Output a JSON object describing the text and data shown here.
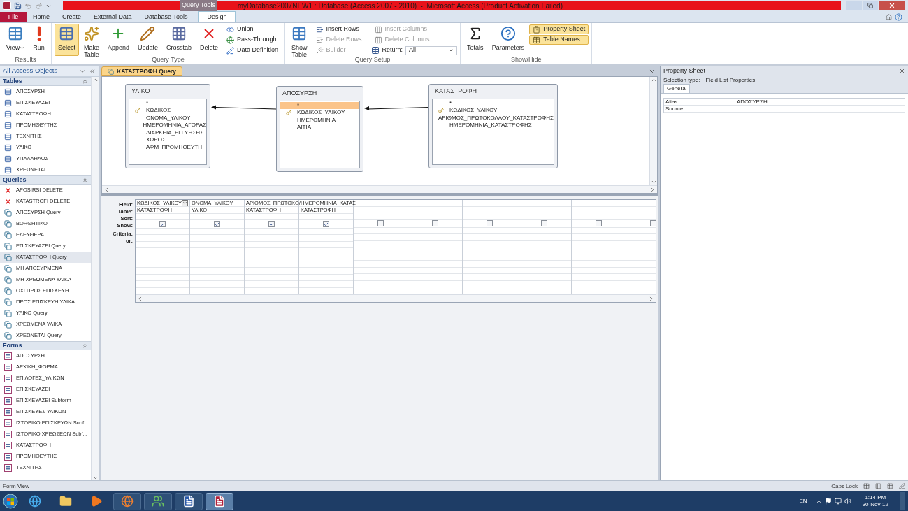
{
  "window": {
    "title": "myDatabase2007NEW1 : Database (Access 2007 - 2010)  -  Microsoft Access (Product Activation Failed)",
    "context_tab": "Query Tools"
  },
  "ribbon_tabs": [
    {
      "label": "File",
      "kind": "file",
      "selected": false
    },
    {
      "label": "Home",
      "kind": "tab",
      "selected": false
    },
    {
      "label": "Create",
      "kind": "tab",
      "selected": false
    },
    {
      "label": "External Data",
      "kind": "tab",
      "selected": false
    },
    {
      "label": "Database Tools",
      "kind": "tab",
      "selected": false
    },
    {
      "label": "Design",
      "kind": "tab",
      "selected": true
    }
  ],
  "ribbon_groups": [
    {
      "label": "Results",
      "items": [
        {
          "label": "View",
          "kind": "large",
          "selected": false,
          "disabled": false,
          "dropdown": true
        },
        {
          "label": "Run",
          "kind": "large",
          "selected": false,
          "disabled": false,
          "dropdown": false
        }
      ]
    },
    {
      "label": "Query Type",
      "items": [
        {
          "label": "Select",
          "kind": "large",
          "selected": true,
          "disabled": false,
          "dropdown": false
        },
        {
          "label": "Make Table",
          "kind": "large",
          "selected": false,
          "disabled": false,
          "dropdown": false
        },
        {
          "label": "Append",
          "kind": "large",
          "selected": false,
          "disabled": false,
          "dropdown": false
        },
        {
          "label": "Update",
          "kind": "large",
          "selected": false,
          "disabled": false,
          "dropdown": false
        },
        {
          "label": "Crosstab",
          "kind": "large",
          "selected": false,
          "disabled": false,
          "dropdown": false
        },
        {
          "label": "Delete",
          "kind": "large",
          "selected": false,
          "disabled": false,
          "dropdown": false
        },
        {
          "label": "Union",
          "kind": "small",
          "selected": false,
          "disabled": false
        },
        {
          "label": "Pass-Through",
          "kind": "small",
          "selected": false,
          "disabled": false
        },
        {
          "label": "Data Definition",
          "kind": "small",
          "selected": false,
          "disabled": false
        }
      ]
    },
    {
      "label": "Query Setup",
      "items": [
        {
          "label": "Show Table",
          "kind": "large",
          "selected": false,
          "disabled": false,
          "dropdown": false
        },
        {
          "label": "Insert Rows",
          "kind": "small",
          "selected": false,
          "disabled": false
        },
        {
          "label": "Delete Rows",
          "kind": "small",
          "selected": false,
          "disabled": true
        },
        {
          "label": "Builder",
          "kind": "small",
          "selected": false,
          "disabled": true
        },
        {
          "label": "Insert Columns",
          "kind": "small",
          "selected": false,
          "disabled": true
        },
        {
          "label": "Delete Columns",
          "kind": "small",
          "selected": false,
          "disabled": true
        },
        {
          "label": "Return:",
          "kind": "combo",
          "value": "All"
        }
      ]
    },
    {
      "label": "Show/Hide",
      "items": [
        {
          "label": "Totals",
          "kind": "large",
          "selected": false,
          "disabled": false,
          "dropdown": false
        },
        {
          "label": "Parameters",
          "kind": "large",
          "selected": false,
          "disabled": false,
          "dropdown": false
        },
        {
          "label": "Property Sheet",
          "kind": "small",
          "selected": true,
          "disabled": false
        },
        {
          "label": "Table Names",
          "kind": "small",
          "selected": true,
          "disabled": false
        }
      ]
    }
  ],
  "navigation": {
    "title": "All Access Objects",
    "sections": [
      {
        "title": "Tables",
        "items": [
          {
            "label": "ΑΠΟΣΥΡΣΗ",
            "kind": "table",
            "selected": false
          },
          {
            "label": "ΕΠΙΣΚΕΥΑΖΕΙ",
            "kind": "table",
            "selected": false
          },
          {
            "label": "ΚΑΤΑΣΤΡΟΦΗ",
            "kind": "table",
            "selected": false
          },
          {
            "label": "ΠΡΟΜΗΘΕΥΤΗΣ",
            "kind": "table",
            "selected": false
          },
          {
            "label": "ΤΕΧΝΙΤΗΣ",
            "kind": "table",
            "selected": false
          },
          {
            "label": "ΥΛΙΚΟ",
            "kind": "table",
            "selected": false
          },
          {
            "label": "ΥΠΑΛΛΗΛΟΣ",
            "kind": "table",
            "selected": false
          },
          {
            "label": "ΧΡΕΩΝΕΤΑΙ",
            "kind": "table",
            "selected": false
          }
        ]
      },
      {
        "title": "Queries",
        "items": [
          {
            "label": "APOSIRSI DELETE",
            "kind": "delete_query",
            "selected": false
          },
          {
            "label": "KATASTROFI DELETE",
            "kind": "delete_query",
            "selected": false
          },
          {
            "label": "ΑΠΟΣΥΡΣΗ Query",
            "kind": "query",
            "selected": false
          },
          {
            "label": "ΒΟΗΘΗΤΙΚΟ",
            "kind": "query",
            "selected": false
          },
          {
            "label": "ΕΛΕΥΘΕΡΑ",
            "kind": "query",
            "selected": false
          },
          {
            "label": "ΕΠΙΣΚΕΥΑΖΕΙ Query",
            "kind": "query",
            "selected": false
          },
          {
            "label": "ΚΑΤΑΣΤΡΟΦΗ Query",
            "kind": "query",
            "selected": true
          },
          {
            "label": "ΜΗ ΑΠΟΣΥΡΜΕΝΑ",
            "kind": "query",
            "selected": false
          },
          {
            "label": "ΜΗ ΧΡΕΩΜΕΝΑ ΥΛΙΚΑ",
            "kind": "query",
            "selected": false
          },
          {
            "label": "ΟΧΙ ΠΡΟΣ ΕΠΙΣΚΕΥΗ",
            "kind": "query",
            "selected": false
          },
          {
            "label": "ΠΡΟΣ ΕΠΙΣΚΕΥΗ ΥΛΙΚΑ",
            "kind": "query",
            "selected": false
          },
          {
            "label": "ΥΛΙΚΟ Query",
            "kind": "query",
            "selected": false
          },
          {
            "label": "ΧΡΕΩΜΕΝΑ ΥΛΙΚΑ",
            "kind": "query",
            "selected": false
          },
          {
            "label": "ΧΡΕΩΝΕΤΑΙ Query",
            "kind": "query",
            "selected": false
          }
        ]
      },
      {
        "title": "Forms",
        "items": [
          {
            "label": "ΑΠΟΣΥΡΣΗ",
            "kind": "form",
            "selected": false
          },
          {
            "label": "ΑΡΧΙΚΗ_ΦΟΡΜΑ",
            "kind": "form",
            "selected": false
          },
          {
            "label": "ΕΠΙΛΟΓΕΣ_ΥΛΙΚΩΝ",
            "kind": "form",
            "selected": false
          },
          {
            "label": "ΕΠΙΣΚΕΥΑΖΕΙ",
            "kind": "form",
            "selected": false
          },
          {
            "label": "ΕΠΙΣΚΕΥΑΖΕΙ Subform",
            "kind": "form",
            "selected": false
          },
          {
            "label": "ΕΠΙΣΚΕΥΕΣ ΥΛΙΚΩΝ",
            "kind": "form",
            "selected": false
          },
          {
            "label": "ΙΣΤΟΡΙΚΟ ΕΠΙΣΚΕΥΩΝ Subf...",
            "kind": "form",
            "selected": false
          },
          {
            "label": "ΙΣΤΟΡΙΚΟ ΧΡΕΩΣΕΩΝ Subf...",
            "kind": "form",
            "selected": false
          },
          {
            "label": "ΚΑΤΑΣΤΡΟΦΗ",
            "kind": "form",
            "selected": false
          },
          {
            "label": "ΠΡΟΜΗΘΕΥΤΗΣ",
            "kind": "form",
            "selected": false
          },
          {
            "label": "ΤΕΧΝΙΤΗΣ",
            "kind": "form",
            "selected": false
          }
        ]
      }
    ]
  },
  "document_tab": {
    "label": "ΚΑΤΑΣΤΡΟΦΗ Query",
    "selected": true
  },
  "field_lists": [
    {
      "title": "ΥΛΙΚΟ",
      "fields": [
        {
          "name": "*",
          "key": false,
          "selected": false
        },
        {
          "name": "ΚΩΔΙΚΟΣ",
          "key": true,
          "selected": false
        },
        {
          "name": "ΟΝΟΜΑ_ΥΛΙΚΟΥ",
          "key": false,
          "selected": false
        },
        {
          "name": "ΗΜΕΡΟΜΗΝΙΑ_ΑΓΟΡΑΣ",
          "key": false,
          "selected": false
        },
        {
          "name": "ΔΙΑΡΚΕΙΑ_ΕΓΓΥΗΣΗΣ",
          "key": false,
          "selected": false
        },
        {
          "name": "ΧΩΡΟΣ",
          "key": false,
          "selected": false
        },
        {
          "name": "ΑΦΜ_ΠΡΟΜΗΘΕΥΤΗ",
          "key": false,
          "selected": false
        }
      ]
    },
    {
      "title": "ΑΠΟΣΥΡΣΗ",
      "fields": [
        {
          "name": "*",
          "key": false,
          "selected": true
        },
        {
          "name": "ΚΩΔΙΚΟΣ_ΥΛΙΚΟΥ",
          "key": true,
          "selected": false
        },
        {
          "name": "ΗΜΕΡΟΜΗΝΙΑ",
          "key": false,
          "selected": false
        },
        {
          "name": "ΑΙΤΙΑ",
          "key": false,
          "selected": false
        }
      ]
    },
    {
      "title": "ΚΑΤΑΣΤΡΟΦΗ",
      "fields": [
        {
          "name": "*",
          "key": false,
          "selected": false
        },
        {
          "name": "ΚΩΔΙΚΟΣ_ΥΛΙΚΟΥ",
          "key": true,
          "selected": false
        },
        {
          "name": "ΑΡΙΘΜΟΣ_ΠΡΩΤΟΚΟΛΛΟΥ_ΚΑΤΑΣΤΡΟΦΗΣ",
          "key": false,
          "selected": false
        },
        {
          "name": "ΗΜΕΡΟΜΗΝΙΑ_ΚΑΤΑΣΤΡΟΦΗΣ",
          "key": false,
          "selected": false
        }
      ]
    }
  ],
  "design_grid": {
    "row_labels": [
      "Field:",
      "Table:",
      "Sort:",
      "Show:",
      "Criteria:",
      "or:"
    ],
    "columns": [
      {
        "field": "ΚΩΔΙΚΟΣ_ΥΛΙΚΟΥ",
        "table": "ΚΑΤΑΣΤΡΟΦΗ",
        "show": true,
        "active": true
      },
      {
        "field": "ΟΝΟΜΑ_ΥΛΙΚΟΥ",
        "table": "ΥΛΙΚΟ",
        "show": true,
        "active": false
      },
      {
        "field": "ΑΡΙΘΜΟΣ_ΠΡΩΤΟΚΟ/",
        "table": "ΚΑΤΑΣΤΡΟΦΗ",
        "show": true,
        "active": false
      },
      {
        "field": "ΗΜΕΡΟΜΗΝΙΑ_ΚΑΤΑΣ",
        "table": "ΚΑΤΑΣΤΡΟΦΗ",
        "show": true,
        "active": false
      },
      {
        "show": false,
        "active": false
      },
      {
        "show": false,
        "active": false
      },
      {
        "show": false,
        "active": false
      },
      {
        "show": false,
        "active": false
      },
      {
        "show": false,
        "active": false
      },
      {
        "show": false,
        "active": false
      }
    ]
  },
  "property_sheet": {
    "title": "Property Sheet",
    "selection_label": "Selection type:",
    "selection_type": "Field List Properties",
    "tabs": [
      {
        "label": "General",
        "selected": true
      }
    ],
    "properties": [
      {
        "name": "Alias",
        "value": "ΑΠΟΣΥΡΣΗ"
      },
      {
        "name": "Source"
      }
    ]
  },
  "status_bar": {
    "left": "Form View",
    "right": "Caps Lock"
  },
  "taskbar": {
    "apps": [
      {
        "kind": "browser",
        "selected": false
      },
      {
        "kind": "folder",
        "selected": false
      },
      {
        "kind": "media",
        "selected": false
      },
      {
        "kind": "firefox",
        "selected": false
      },
      {
        "kind": "people",
        "selected": false
      },
      {
        "kind": "word",
        "selected": false
      },
      {
        "kind": "access",
        "selected": true
      }
    ],
    "language": "EN",
    "time": "1:14 PM",
    "date": "30-Nov-12"
  }
}
